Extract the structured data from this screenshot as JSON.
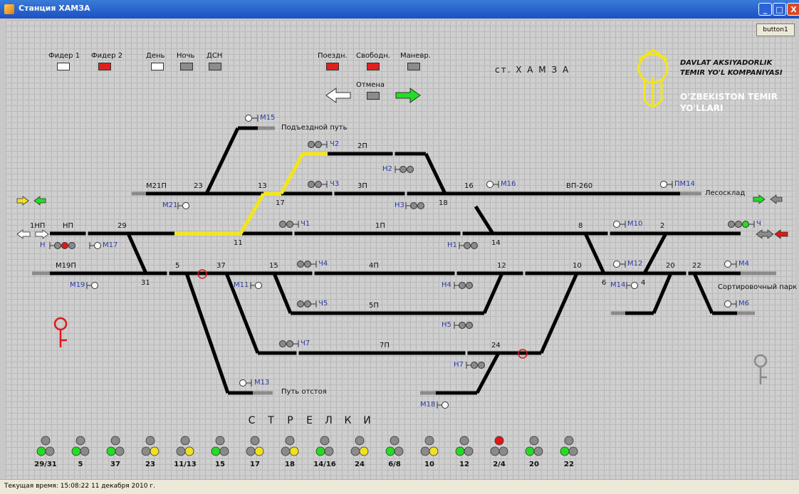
{
  "window": {
    "title": "Станция ХАМЗА",
    "button1": "button1"
  },
  "indicators": {
    "feeder1": {
      "label": "Фидер 1",
      "color": "#ffffff"
    },
    "feeder2": {
      "label": "Фидер 2",
      "color": "#e02020"
    },
    "day": {
      "label": "День",
      "color": "#ffffff"
    },
    "night": {
      "label": "Ночь",
      "color": "#8c8c8c"
    },
    "dsn": {
      "label": "ДСН",
      "color": "#8c8c8c"
    },
    "train": {
      "label": "Поездн.",
      "color": "#e02020"
    },
    "free": {
      "label": "Свободн.",
      "color": "#e02020"
    },
    "shunt": {
      "label": "Маневр.",
      "color": "#8c8c8c"
    },
    "cancel": {
      "label": "Отмена",
      "color": "#8c8c8c"
    }
  },
  "station_name": "ст. Х А М З А",
  "logo": {
    "line1": "DAVLAT AKSIYADORLIK",
    "line2": "TEMIR YO'L KOMPANIYASI",
    "line3": "O'ZBEKISTON TEMIR",
    "line4": "YO'LLARI"
  },
  "track_labels": {
    "podezd": "Подъездной путь",
    "lesosklad": "Лесосклад",
    "sort_park": "Сортировочный парк",
    "otstoy": "Путь отстоя",
    "t1np": "1НП",
    "tnp": "НП",
    "t29": "29",
    "t1p": "1П",
    "t8": "8",
    "t2": "2",
    "t2p": "2П",
    "t3p": "3П",
    "t13": "13",
    "t23": "23",
    "tm21p": "М21П",
    "t16": "16",
    "tvp260": "ВП-260",
    "t17": "17",
    "t18": "18",
    "t11": "11",
    "t14": "14",
    "tm19p": "М19П",
    "t5": "5",
    "t37": "37",
    "t15": "15",
    "t4p": "4П",
    "t12": "12",
    "t10": "10",
    "t20": "20",
    "t22": "22",
    "t31": "31",
    "t6": "6",
    "t4": "4",
    "t5p": "5П",
    "t7p": "7П",
    "t24": "24"
  },
  "signals": {
    "m15": "М15",
    "ch2": "Ч2",
    "n2": "Н2",
    "ch3": "Ч3",
    "m16": "М16",
    "pm14": "ПМ14",
    "m21": "М21",
    "n3": "Н3",
    "ch1": "Ч1",
    "m10": "М10",
    "ch": "Ч",
    "n": "Н",
    "m17": "М17",
    "n1": "Н1",
    "ch4": "Ч4",
    "m12": "М12",
    "m4": "М4",
    "m19": "М19",
    "m11": "М11",
    "n4": "Н4",
    "m14": "М14",
    "ch5": "Ч5",
    "n5": "Н5",
    "m6": "М6",
    "ch7": "Ч7",
    "n7": "Н7",
    "m13": "М13",
    "m18": "М18"
  },
  "switches_title": [
    "С",
    "Т",
    "Р",
    "Е",
    "Л",
    "К",
    "И"
  ],
  "switches": [
    {
      "label": "29/31",
      "top": "gray",
      "left": "green",
      "right": "gray"
    },
    {
      "label": "5",
      "top": "gray",
      "left": "green",
      "right": "gray"
    },
    {
      "label": "37",
      "top": "gray",
      "left": "green",
      "right": "gray"
    },
    {
      "label": "23",
      "top": "gray",
      "left": "gray",
      "right": "yellow"
    },
    {
      "label": "11/13",
      "top": "gray",
      "left": "gray",
      "right": "yellow"
    },
    {
      "label": "15",
      "top": "gray",
      "left": "green",
      "right": "gray"
    },
    {
      "label": "17",
      "top": "gray",
      "left": "gray",
      "right": "yellow"
    },
    {
      "label": "18",
      "top": "gray",
      "left": "gray",
      "right": "yellow"
    },
    {
      "label": "14/16",
      "top": "gray",
      "left": "green",
      "right": "gray"
    },
    {
      "label": "24",
      "top": "gray",
      "left": "gray",
      "right": "yellow"
    },
    {
      "label": "6/8",
      "top": "gray",
      "left": "green",
      "right": "gray"
    },
    {
      "label": "10",
      "top": "gray",
      "left": "gray",
      "right": "yellow"
    },
    {
      "label": "12",
      "top": "gray",
      "left": "green",
      "right": "gray"
    },
    {
      "label": "2/4",
      "top": "red",
      "left": "gray",
      "right": "gray"
    },
    {
      "label": "20",
      "top": "gray",
      "left": "green",
      "right": "gray"
    },
    {
      "label": "22",
      "top": "gray",
      "left": "green",
      "right": "gray"
    }
  ],
  "status": {
    "text": "Текущая время: 15:08:22  11 декабря 2010 г."
  },
  "colors": {
    "route": "#f2e51a",
    "track": "#000000",
    "green": "#22dd22",
    "yellow": "#f0e020",
    "red": "#e01818",
    "gray": "#8a8a8a",
    "blue_label": "#2a3aa6"
  }
}
